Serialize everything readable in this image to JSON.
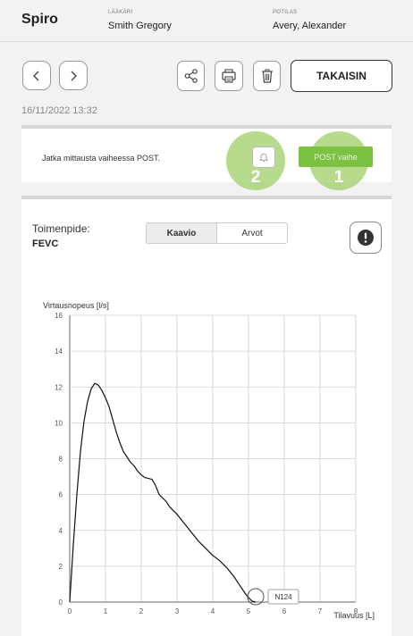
{
  "header": {
    "app_title": "Spiro",
    "doctor_label": "LÄÄKÄRI",
    "doctor_name": "Smith Gregory",
    "patient_label": "POTILAS",
    "patient_name": "Avery, Alexander"
  },
  "toolbar": {
    "back_label": "TAKAISIN",
    "icons": [
      "chevron-left-icon",
      "chevron-right-icon",
      "share-icon",
      "print-icon",
      "trash-icon"
    ]
  },
  "timestamp": "16/11/2022 13:32",
  "notice": {
    "message": "Jatka mittausta vaiheessa POST.",
    "post_button_label": "POST vaihe",
    "markers": [
      "2",
      "1"
    ],
    "accent_color": "#7cc142"
  },
  "measurement": {
    "procedure_label": "Toimenpide:",
    "procedure_value": "FEVC",
    "tabs": [
      {
        "label": "Kaavio",
        "active": true
      },
      {
        "label": "Arvot",
        "active": false
      }
    ]
  },
  "chart_data": {
    "type": "line",
    "ylabel": "Virtausnopeus [l/s]",
    "xlabel": "Tilavuus [L]",
    "xlim": [
      0,
      8
    ],
    "ylim": [
      0,
      16
    ],
    "x_ticks": [
      0,
      1,
      2,
      3,
      4,
      5,
      6,
      7,
      8
    ],
    "y_ticks": [
      0,
      2,
      4,
      6,
      8,
      10,
      12,
      14,
      16
    ],
    "grid": true,
    "series": [
      {
        "x": [
          0,
          0.1,
          0.2,
          0.3,
          0.4,
          0.5,
          0.6,
          0.7,
          0.8,
          0.9,
          1.0,
          1.1,
          1.2,
          1.3,
          1.4,
          1.5,
          1.6,
          1.7,
          1.8,
          1.9,
          2.0,
          2.1,
          2.2,
          2.3,
          2.4,
          2.5,
          2.6,
          2.7,
          2.8,
          2.9,
          3.0,
          3.2,
          3.4,
          3.6,
          3.8,
          4.0,
          4.2,
          4.4,
          4.6,
          4.7,
          4.8,
          4.9,
          5.0,
          5.1,
          5.2
        ],
        "y": [
          0,
          3.2,
          6.0,
          8.4,
          10.1,
          11.2,
          11.9,
          12.2,
          12.1,
          11.8,
          11.4,
          10.9,
          10.2,
          9.5,
          8.9,
          8.4,
          8.1,
          7.8,
          7.6,
          7.3,
          7.1,
          6.95,
          6.9,
          6.85,
          6.5,
          6.0,
          5.8,
          5.6,
          5.3,
          5.1,
          4.9,
          4.4,
          3.9,
          3.4,
          3.0,
          2.6,
          2.3,
          1.9,
          1.4,
          1.1,
          0.8,
          0.5,
          0.25,
          0.05,
          0
        ]
      }
    ],
    "annotations": [
      {
        "x": 5.2,
        "y": 0,
        "label": "N124"
      }
    ]
  }
}
